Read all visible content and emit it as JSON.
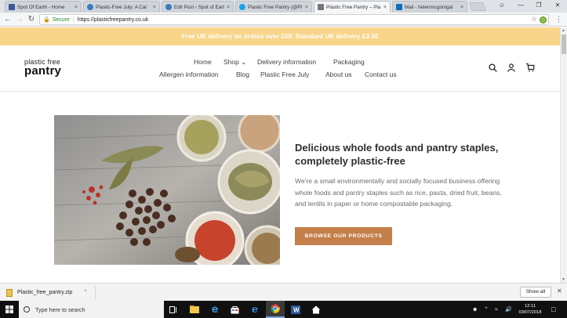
{
  "browser": {
    "tabs": [
      {
        "title": "Spot Of Earth - Home",
        "favicon_color": "#3b5998"
      },
      {
        "title": "Plastic-Free July: A Cal",
        "favicon_color": "#3b7bbf"
      },
      {
        "title": "Edit Post ‹ Spot of Earth",
        "favicon_color": "#3b7bbf"
      },
      {
        "title": "Plastic Free Pantry (@Pl",
        "favicon_color": "#1da1f2"
      },
      {
        "title": "Plastic Free Pantry – Pla",
        "favicon_color": "#777777"
      },
      {
        "title": "Mail - helenmcgonigal",
        "favicon_color": "#0f6cbd"
      }
    ],
    "active_tab_index": 4,
    "close_glyph": "×",
    "secure_label": "Secure",
    "url": "https://plasticfreepantry.co.uk",
    "window_controls": {
      "user": "☺",
      "minimize": "—",
      "maximize": "❐",
      "close": "✕"
    }
  },
  "announcement": {
    "text": "Free UK delivery on orders over £50. Standard UK delivery £3.50",
    "bg_color": "#f8d58a"
  },
  "header": {
    "logo": {
      "line1": "plastic free",
      "line2": "pantry"
    },
    "nav_row1": [
      {
        "label": "Home"
      },
      {
        "label": "Shop ⌄"
      },
      {
        "label": "Delivery information"
      },
      {
        "label": "Packaging"
      }
    ],
    "nav_row2": [
      {
        "label": "Allergen information"
      },
      {
        "label": "Blog"
      },
      {
        "label": "Plastic Free July"
      },
      {
        "label": "About us"
      },
      {
        "label": "Contact us"
      }
    ],
    "icons": [
      "search-icon",
      "account-icon",
      "cart-icon"
    ]
  },
  "hero": {
    "headline": "Delicious whole foods and pantry staples, completely plastic-free",
    "description": "We're a small environmentally and socially focused business offering whole foods and pantry staples such as rice, pasta, dried fruit, beans, and lentils in paper or home compostable packaging.",
    "cta_label": "BROWSE OUR PRODUCTS",
    "cta_color": "#c47f4b"
  },
  "download_bar": {
    "filename": "Plastic_free_pantry.zip",
    "show_all_label": "Show all"
  },
  "taskbar": {
    "search_placeholder": "Type here to search",
    "time": "12:11",
    "date": "03/07/2018"
  }
}
